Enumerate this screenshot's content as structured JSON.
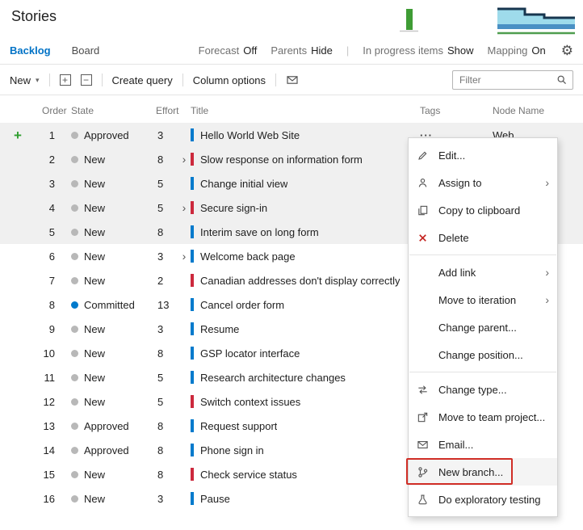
{
  "header": {
    "title": "Stories"
  },
  "view_tabs": {
    "backlog": "Backlog",
    "board": "Board",
    "toggles": [
      {
        "label": "Forecast",
        "value": "Off"
      },
      {
        "label": "Parents",
        "value": "Hide"
      },
      {
        "label": "In progress items",
        "value": "Show"
      },
      {
        "label": "Mapping",
        "value": "On"
      }
    ]
  },
  "toolbar": {
    "new_label": "New",
    "create_query_label": "Create query",
    "column_options_label": "Column options",
    "filter_placeholder": "Filter"
  },
  "grid": {
    "columns": [
      "Order",
      "State",
      "Effort",
      "Title",
      "Tags",
      "Node Name"
    ],
    "rows": [
      {
        "order": "1",
        "state": "Approved",
        "effort": "3",
        "title": "Hello World Web Site",
        "type": "story",
        "expandable": false,
        "selected": true,
        "add_icon": true,
        "ellipsis": true,
        "node_name": "Web"
      },
      {
        "order": "2",
        "state": "New",
        "effort": "8",
        "title": "Slow response on information form",
        "type": "bug",
        "expandable": true,
        "selected": true,
        "add_icon": false,
        "ellipsis": false,
        "node_name": ""
      },
      {
        "order": "3",
        "state": "New",
        "effort": "5",
        "title": "Change initial view",
        "type": "story",
        "expandable": false,
        "selected": true,
        "add_icon": false,
        "ellipsis": false,
        "node_name": ""
      },
      {
        "order": "4",
        "state": "New",
        "effort": "5",
        "title": "Secure sign-in",
        "type": "bug",
        "expandable": true,
        "selected": true,
        "add_icon": false,
        "ellipsis": false,
        "node_name": ""
      },
      {
        "order": "5",
        "state": "New",
        "effort": "8",
        "title": "Interim save on long form",
        "type": "story",
        "expandable": false,
        "selected": true,
        "add_icon": false,
        "ellipsis": false,
        "node_name": ""
      },
      {
        "order": "6",
        "state": "New",
        "effort": "3",
        "title": "Welcome back page",
        "type": "story",
        "expandable": true,
        "selected": false,
        "add_icon": false,
        "ellipsis": false,
        "node_name": ""
      },
      {
        "order": "7",
        "state": "New",
        "effort": "2",
        "title": "Canadian addresses don't display correctly",
        "type": "bug",
        "expandable": false,
        "selected": false,
        "add_icon": false,
        "ellipsis": false,
        "node_name": ""
      },
      {
        "order": "8",
        "state": "Committed",
        "effort": "13",
        "title": "Cancel order form",
        "type": "story",
        "expandable": false,
        "selected": false,
        "add_icon": false,
        "ellipsis": false,
        "node_name": ""
      },
      {
        "order": "9",
        "state": "New",
        "effort": "3",
        "title": "Resume",
        "type": "story",
        "expandable": false,
        "selected": false,
        "add_icon": false,
        "ellipsis": false,
        "node_name": ""
      },
      {
        "order": "10",
        "state": "New",
        "effort": "8",
        "title": "GSP locator interface",
        "type": "story",
        "expandable": false,
        "selected": false,
        "add_icon": false,
        "ellipsis": false,
        "node_name": ""
      },
      {
        "order": "11",
        "state": "New",
        "effort": "5",
        "title": "Research architecture changes",
        "type": "story",
        "expandable": false,
        "selected": false,
        "add_icon": false,
        "ellipsis": false,
        "node_name": ""
      },
      {
        "order": "12",
        "state": "New",
        "effort": "5",
        "title": "Switch context issues",
        "type": "bug",
        "expandable": false,
        "selected": false,
        "add_icon": false,
        "ellipsis": false,
        "node_name": ""
      },
      {
        "order": "13",
        "state": "Approved",
        "effort": "8",
        "title": "Request support",
        "type": "story",
        "expandable": false,
        "selected": false,
        "add_icon": false,
        "ellipsis": false,
        "node_name": ""
      },
      {
        "order": "14",
        "state": "Approved",
        "effort": "8",
        "title": "Phone sign in",
        "type": "story",
        "expandable": false,
        "selected": false,
        "add_icon": false,
        "ellipsis": false,
        "node_name": ""
      },
      {
        "order": "15",
        "state": "New",
        "effort": "8",
        "title": "Check service status",
        "type": "bug",
        "expandable": false,
        "selected": false,
        "add_icon": false,
        "ellipsis": false,
        "node_name": ""
      },
      {
        "order": "16",
        "state": "New",
        "effort": "3",
        "title": "Pause",
        "type": "story",
        "expandable": false,
        "selected": false,
        "add_icon": false,
        "ellipsis": false,
        "node_name": ""
      }
    ]
  },
  "context_menu": {
    "items": [
      {
        "label": "Edit...",
        "icon": "pencil"
      },
      {
        "label": "Assign to",
        "icon": "person",
        "submenu": true
      },
      {
        "label": "Copy to clipboard",
        "icon": "copy"
      },
      {
        "label": "Delete",
        "icon": "delete"
      },
      {
        "separator": true
      },
      {
        "label": "Add link",
        "submenu": true
      },
      {
        "label": "Move to iteration",
        "submenu": true
      },
      {
        "label": "Change parent..."
      },
      {
        "label": "Change position..."
      },
      {
        "separator": true
      },
      {
        "label": "Change type...",
        "icon": "change-type"
      },
      {
        "label": "Move to team project...",
        "icon": "move-project"
      },
      {
        "label": "Email...",
        "icon": "email"
      },
      {
        "label": "New branch...",
        "icon": "branch",
        "highlighted": true,
        "annotated": true
      },
      {
        "label": "Do exploratory testing",
        "icon": "beaker"
      }
    ]
  },
  "colors": {
    "accent": "#0072c6",
    "story_bar": "#007acc",
    "bug_bar": "#cc293d",
    "committed_dot": "#007acc",
    "default_dot": "#b8b8b8",
    "add_plus": "#2f9e2f",
    "annotation": "#d02e26",
    "chart_green": "#3f9c35",
    "chart_cyan": "#9edbeb",
    "chart_blue": "#4a90c4",
    "chart_navy": "#17364f"
  }
}
